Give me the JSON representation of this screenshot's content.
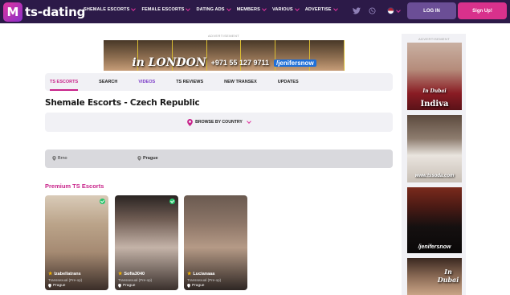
{
  "header": {
    "logo_text": "ts-dating",
    "logo_mark": "M",
    "nav": [
      {
        "label": "SHEMALE ESCORTS"
      },
      {
        "label": "FEMALE ESCORTS"
      },
      {
        "label": "DATING ADS"
      },
      {
        "label": "MEMBERS"
      },
      {
        "label": "VARIOUS"
      },
      {
        "label": "ADVERTISE"
      }
    ],
    "login_label": "LOG IN",
    "signup_label": "Sign Up!",
    "icons": [
      "twitter-icon",
      "whatsapp-icon",
      "flag-us-icon"
    ]
  },
  "top_ad": {
    "label": "ADVERTISEMENT",
    "city": "in LONDON",
    "phone": "+971 55 127 9711",
    "handle": "/jenifersnow"
  },
  "tabs": [
    {
      "label": "TS ESCORTS",
      "state": "active"
    },
    {
      "label": "SEARCH",
      "state": "normal"
    },
    {
      "label": "VIDEOS",
      "state": "purple"
    },
    {
      "label": "TS REVIEWS",
      "state": "normal"
    },
    {
      "label": "NEW TRANSEX",
      "state": "normal"
    },
    {
      "label": "UPDATES",
      "state": "normal"
    }
  ],
  "page_title": "Shemale Escorts - Czech Republic",
  "browse_label": "BROWSE BY COUNTRY",
  "cities": [
    {
      "name": "Brno",
      "bold": false
    },
    {
      "name": "Prague",
      "bold": true
    }
  ],
  "premium_title": "Premium TS Escorts",
  "cards": [
    {
      "name": "Izabellatrans",
      "type": "Transsexual (Pre-op)",
      "location": "Prague"
    },
    {
      "name": "Sofia3040",
      "type": "Transsexual (Pre-op)",
      "location": "Prague"
    },
    {
      "name": "Lucianaaa",
      "type": "Transsexual (Pre-op)",
      "location": "Prague"
    }
  ],
  "sidebar": {
    "label": "ADVERTISEMENT",
    "ads": [
      {
        "top_text": "In Dubai",
        "bottom_text": "Indiva"
      },
      {
        "top_text": "",
        "bottom_text": "www.tssoda.com"
      },
      {
        "top_text": "",
        "bottom_text": "/jenifersnow"
      },
      {
        "top_text": "In Dubai",
        "bottom_text": ""
      }
    ]
  },
  "colors": {
    "header_bg": "#2c1a48",
    "accent": "#c8238a",
    "login_bg": "#6b4e96",
    "signup_bg": "#d9318c",
    "verified": "#27c46b"
  }
}
